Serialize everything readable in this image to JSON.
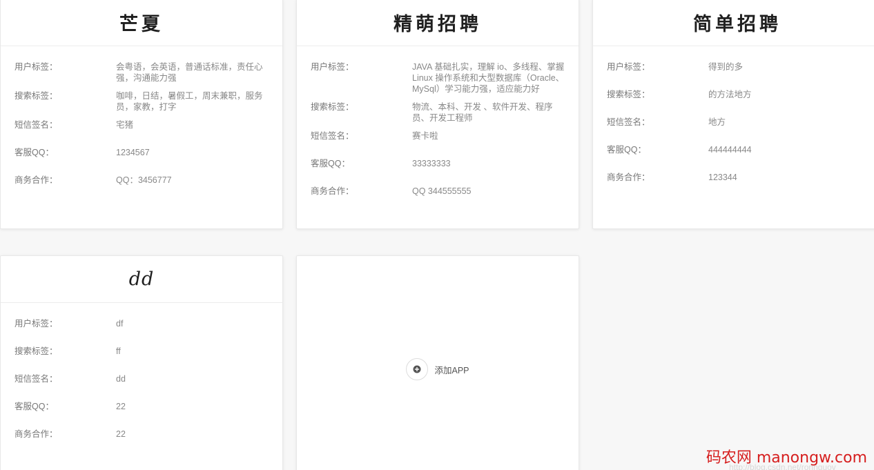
{
  "cards": [
    {
      "title": "芒夏",
      "rows": [
        {
          "label": "用户标签：",
          "value": "会粤语，会英语，普通话标准，责任心强，沟通能力强"
        },
        {
          "label": "搜索标签：",
          "value": "咖啡，日结，暑假工，周末兼职，服务员，家教，打字"
        },
        {
          "label": "短信签名：",
          "value": "宅猪"
        },
        {
          "label": "客服QQ：",
          "value": "1234567"
        },
        {
          "label": "商务合作：",
          "value": "QQ：3456777"
        }
      ]
    },
    {
      "title": "精萌招聘",
      "rows": [
        {
          "label": "用户标签：",
          "value": "JAVA 基础扎实，理解 io、多线程、掌握 Linux 操作系统和大型数据库（Oracle、MySql）学习能力强，适应能力好"
        },
        {
          "label": "搜索标签：",
          "value": "物流、本科、开发 、软件开发、程序员、开发工程师"
        },
        {
          "label": "短信签名：",
          "value": "赛卡啦"
        },
        {
          "label": "客服QQ：",
          "value": "33333333"
        },
        {
          "label": "商务合作：",
          "value": "QQ 344555555"
        }
      ]
    },
    {
      "title": "简单招聘",
      "rows": [
        {
          "label": "用户标签：",
          "value": "得到的多"
        },
        {
          "label": "搜索标签：",
          "value": "的方法地方"
        },
        {
          "label": "短信签名：",
          "value": "地方"
        },
        {
          "label": "客服QQ：",
          "value": "444444444"
        },
        {
          "label": "商务合作：",
          "value": "123344"
        }
      ]
    },
    {
      "title": "dd",
      "rows": [
        {
          "label": "用户标签：",
          "value": "df"
        },
        {
          "label": "搜索标签：",
          "value": "ff"
        },
        {
          "label": "短信签名：",
          "value": "dd"
        },
        {
          "label": "客服QQ：",
          "value": "22"
        },
        {
          "label": "商务合作：",
          "value": "22"
        }
      ]
    }
  ],
  "add_app": {
    "label": "添加APP",
    "icon": "plus-circle-icon"
  },
  "watermark": {
    "text": "码农网 manongw.com",
    "url": "http://blog.csdn.net/ronnguov"
  }
}
